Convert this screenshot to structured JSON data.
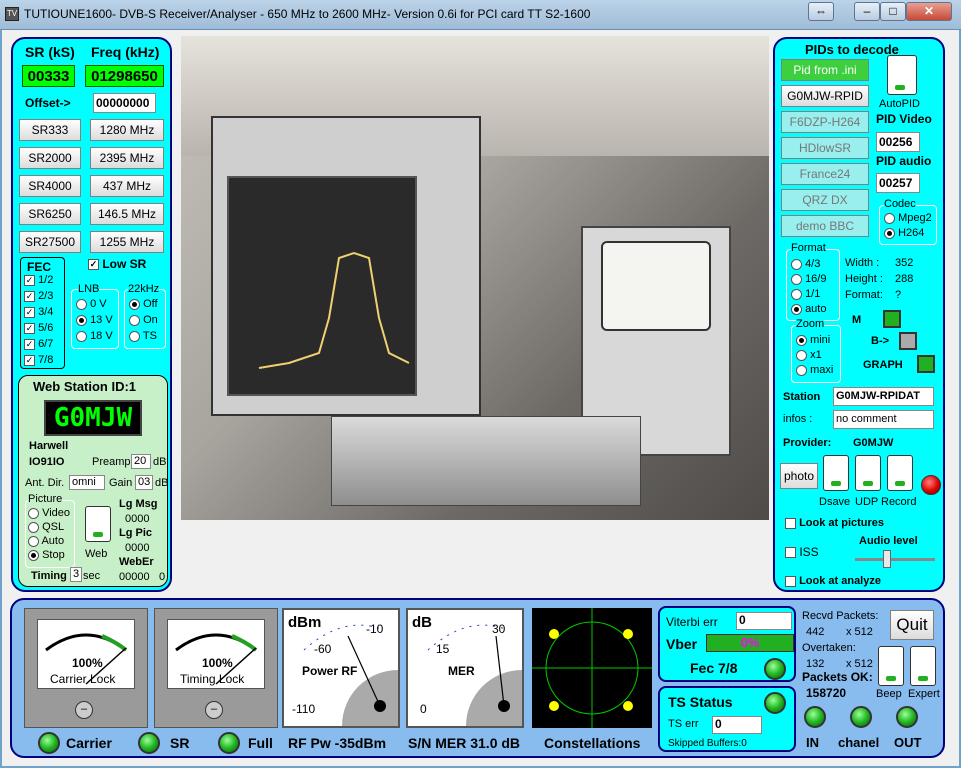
{
  "window": {
    "title": "TUTIOUNE1600- DVB-S Receiver/Analyser - 650 MHz to 2600 MHz- Version 0.6i for PCI card TT S2-1600",
    "icon": "app-icon"
  },
  "left": {
    "sr_header": "SR (kS)",
    "freq_header": "Freq (kHz)",
    "sr_value": "00333",
    "freq_value": "01298650",
    "offset_label": "Offset->",
    "offset_value": "00000000",
    "sr_buttons": [
      "SR333",
      "SR2000",
      "SR4000",
      "SR6250",
      "SR27500"
    ],
    "freq_buttons": [
      "1280 MHz",
      "2395 MHz",
      "437 MHz",
      "146.5 MHz",
      "1255 MHz"
    ],
    "fec_label": "FEC",
    "fec_items": [
      "1/2",
      "2/3",
      "3/4",
      "5/6",
      "6/7",
      "7/8"
    ],
    "low_sr": "Low SR",
    "lnb_label": "LNB",
    "lnb_items": [
      "0 V",
      "13 V",
      "18 V"
    ],
    "khz_label": "22kHz",
    "khz_items": [
      "Off",
      "On",
      "TS"
    ],
    "web_station": "Web Station ID:1",
    "callsign": "G0MJW",
    "location": "Harwell",
    "locator": "IO91IO",
    "preamp_label": "Preamp",
    "preamp_value": "20",
    "db": "dB",
    "ant_label": "Ant. Dir.",
    "ant_value": "omni",
    "gain_label": "Gain",
    "gain_value": "03",
    "picture_label": "Picture",
    "picture_items": [
      "Video",
      "QSL",
      "Auto",
      "Stop"
    ],
    "web_label": "Web",
    "lg_msg": "Lg Msg",
    "lg_msg_val": "0000",
    "lg_pic": "Lg Pic",
    "lg_pic_val": "0000",
    "weber": "WebEr",
    "weber_val": "00000",
    "weber_val2": "0",
    "timing_label": "Timing",
    "timing_value": "3",
    "sec": "sec"
  },
  "right": {
    "pids_title": "PIDs to decode",
    "buttons": [
      "Pid from .ini",
      "G0MJW-RPID",
      "F6DZP-H264",
      "HDlowSR",
      "France24",
      "QRZ DX",
      "demo BBC"
    ],
    "autopid": "AutoPID",
    "pid_video_label": "PID Video",
    "pid_video": "00256",
    "pid_audio_label": "PID audio",
    "pid_audio": "00257",
    "codec_label": "Codec",
    "codec_items": [
      "Mpeg2",
      "H264"
    ],
    "format_label": "Format",
    "format_items": [
      "4/3",
      "16/9",
      "1/1",
      "auto"
    ],
    "width_label": "Width :",
    "width": "352",
    "height_label": "Height :",
    "height": "288",
    "format2_label": "Format:",
    "format2": "?",
    "m_label": "M",
    "b_label": "B->",
    "graph_label": "GRAPH",
    "zoom_label": "Zoom",
    "zoom_items": [
      "mini",
      "x1",
      "maxi"
    ],
    "station_label": "Station",
    "station": "G0MJW-RPIDAT",
    "infos_label": "infos :",
    "infos": "no comment",
    "provider_label": "Provider:",
    "provider": "G0MJW",
    "photo": "photo",
    "dsave": "Dsave",
    "udp": "UDP",
    "record": "Record",
    "look_pictures": "Look at pictures",
    "iss": "ISS",
    "audio_level": "Audio level",
    "look_analyze": "Look at analyze"
  },
  "bottom": {
    "meter1_pct": "100%",
    "meter1_name": "Carrier Lock",
    "meter1_level": 1.0,
    "meter2_pct": "100%",
    "meter2_name": "Timing Lock",
    "meter2_level": 1.0,
    "dbm_unit": "dBm",
    "dbm_ticks": [
      "-60",
      "-10",
      "-110"
    ],
    "power_rf": "Power RF",
    "db_unit": "dB",
    "db_ticks": [
      "15",
      "30",
      "0"
    ],
    "mer": "MER",
    "carrier": "Carrier",
    "sr": "SR",
    "full": "Full",
    "rf_pw": "RF Pw -35dBm",
    "sn_mer": "S/N MER  31.0 dB",
    "constellations": "Constellations",
    "viterbi_label": "Viterbi err",
    "viterbi": "0",
    "vber_label": "Vber",
    "vber": "0%",
    "fec": "Fec 7/8",
    "ts_status": "TS Status",
    "ts_err_label": "TS err",
    "ts_err": "0",
    "skipped": "Skipped Buffers:0",
    "recvd": "Recvd Packets:",
    "recvd_val": "442",
    "x512": "x 512",
    "overtaken": "Overtaken:",
    "over_val": "132",
    "x512b": "x 512",
    "packets_ok": "Packets OK:",
    "packets_val": "158720",
    "quit": "Quit",
    "beep": "Beep",
    "expert": "Expert",
    "in": "IN",
    "chanel": "chanel",
    "out": "OUT"
  }
}
